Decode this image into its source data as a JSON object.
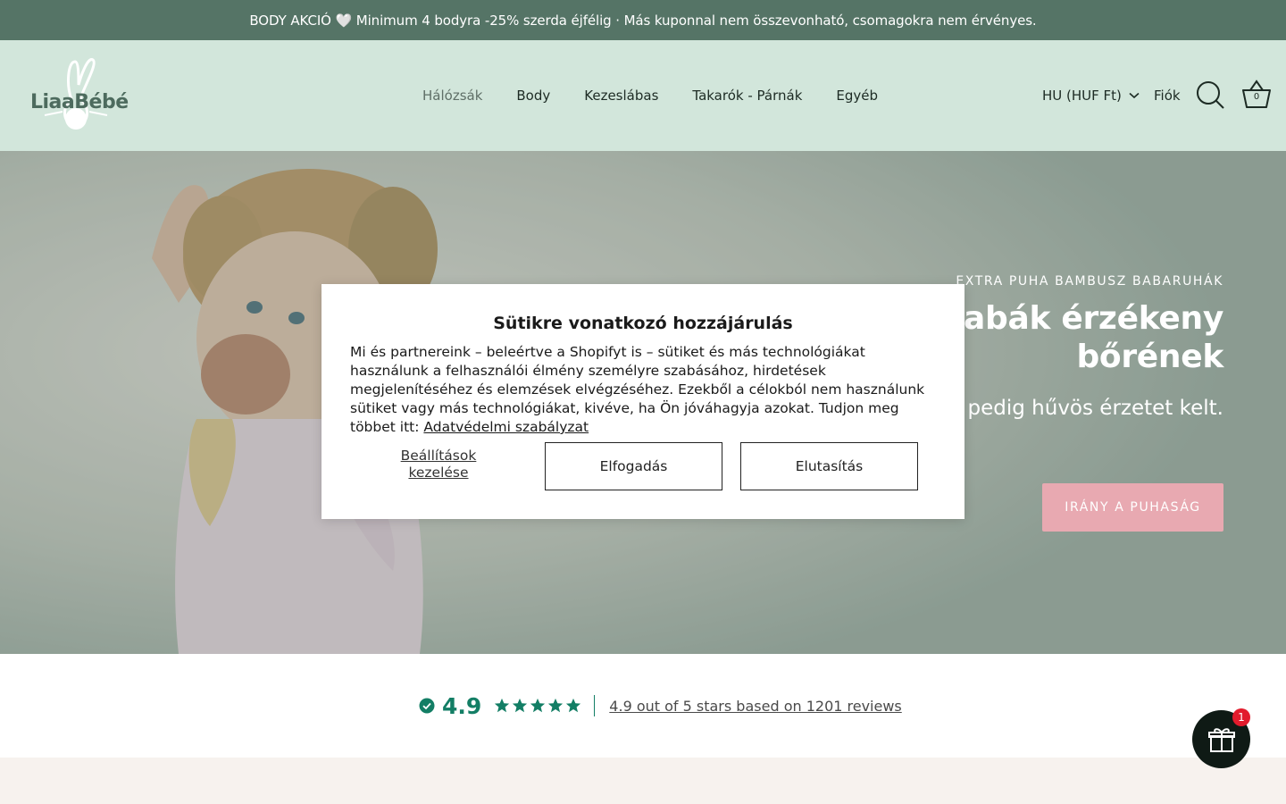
{
  "announcement": {
    "text": "BODY AKCIÓ 🤍 Minimum 4 bodyra -25% szerda éjfélig · Más kuponnal nem összevonható, csomagokra nem érvényes."
  },
  "header": {
    "logo_text": "LiaaBébé",
    "nav": [
      {
        "label": "Hálózsák"
      },
      {
        "label": "Body"
      },
      {
        "label": "Kezeslábas"
      },
      {
        "label": "Takarók - Párnák"
      },
      {
        "label": "Egyéb"
      }
    ],
    "locale": "HU (HUF Ft)",
    "account": "Fiók",
    "cart_count": "0"
  },
  "hero": {
    "subtitle": "EXTRA PUHA BAMBUSZ BABARUHÁK",
    "title": "A babák érzékeny bőrének",
    "text": "meleg, nyáron pedig hűvös érzetet kelt.",
    "cta": "IRÁNY A PUHASÁG"
  },
  "reviews": {
    "score": "4.9",
    "stars": 5,
    "link_text": "4.9 out of 5 stars based on 1201 reviews",
    "accent_color": "#137e65"
  },
  "cookie": {
    "title": "Sütikre vonatkozó hozzájárulás",
    "body": "Mi és partnereink – beleértve a Shopifyt is – sütiket és más technológiákat használunk a felhasználói élmény személyre szabásához, hirdetések megjelenítéséhez és elemzések elvégzéséhez. Ezekből a célokból nem használunk sütiket vagy más technológiákat, kivéve, ha Ön jóváhagyja azokat. Tudjon meg többet itt:",
    "link": "Adatvédelmi szabályzat",
    "manage": "Beállítások kezelése",
    "accept": "Elfogadás",
    "reject": "Elutasítás"
  },
  "gift": {
    "badge": "1"
  }
}
